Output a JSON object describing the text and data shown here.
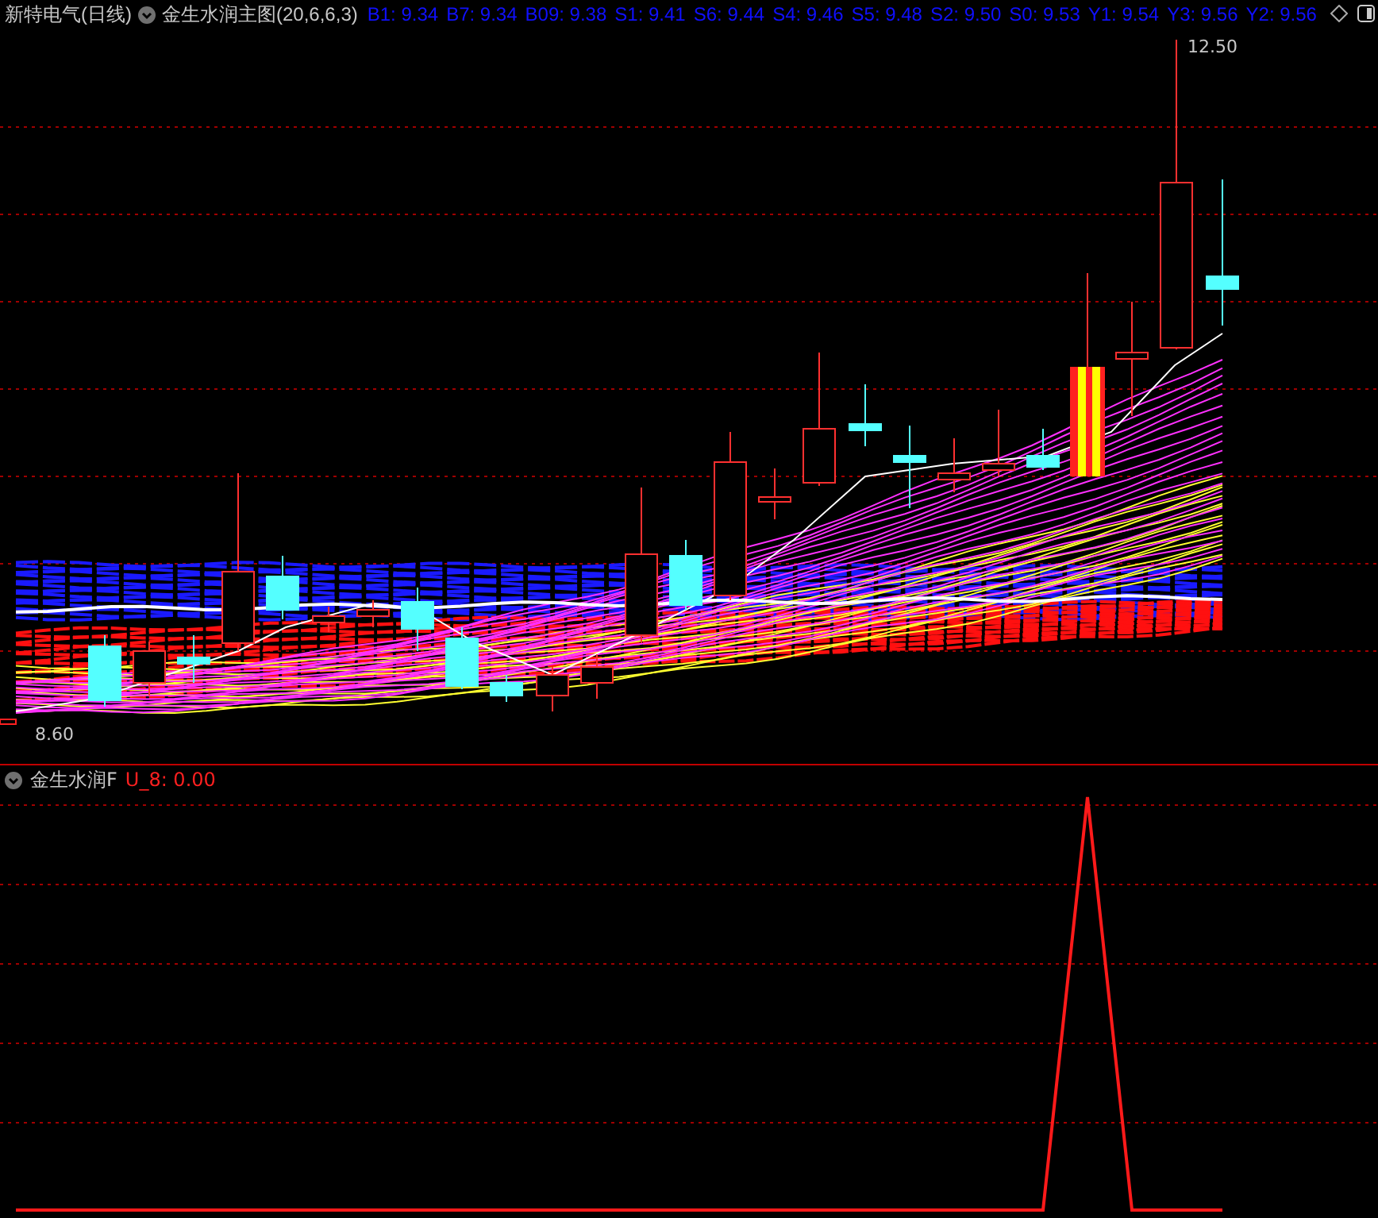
{
  "header": {
    "stock_name": "新特电气(日线)",
    "indicator": "金生水润主图(20,6,6,3)",
    "values": [
      "B1: 9.34",
      "B7: 9.34",
      "B09: 9.38",
      "S1: 9.41",
      "S6: 9.44",
      "S4: 9.46",
      "S5: 9.48",
      "S2: 9.50",
      "S0: 9.53",
      "Y1: 9.54",
      "Y3: 9.56",
      "Y2: 9.56"
    ]
  },
  "main_chart": {
    "high_label": "12.50",
    "low_label": "8.60"
  },
  "lower_panel": {
    "name": "金生水润F",
    "value": "U_8: 0.00"
  }
}
